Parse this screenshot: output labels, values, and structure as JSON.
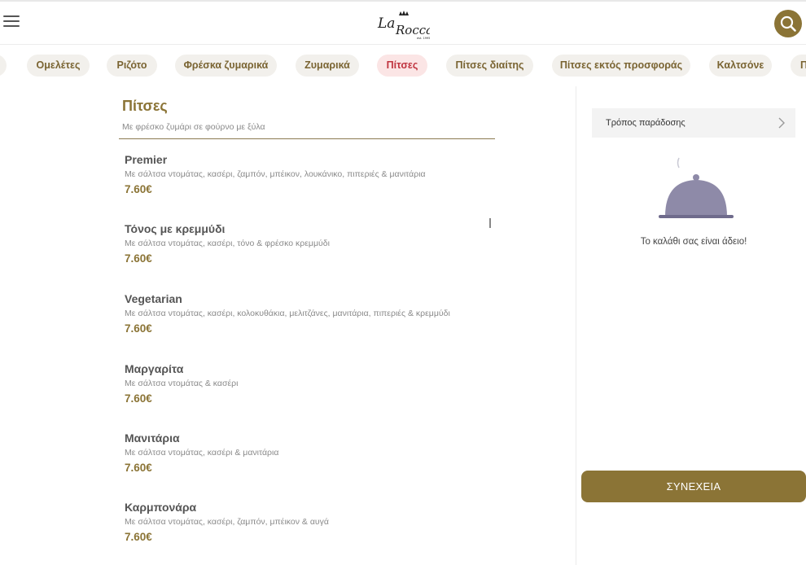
{
  "header": {
    "logo_text": "La Rocca",
    "menu_icon": "hamburger-menu-icon",
    "search_icon": "search-icon",
    "accent_color": "#8b7436"
  },
  "categories": [
    {
      "label": "Ομελέτες",
      "active": false
    },
    {
      "label": "Ριζότο",
      "active": false
    },
    {
      "label": "Φρέσκα ζυμαρικά",
      "active": false
    },
    {
      "label": "Ζυμαρικά",
      "active": false
    },
    {
      "label": "Πίτσες",
      "active": true
    },
    {
      "label": "Πίτσες διαίτης",
      "active": false
    },
    {
      "label": "Πίτσες εκτός προσφοράς",
      "active": false
    },
    {
      "label": "Καλτσόνε",
      "active": false
    },
    {
      "label": "Π",
      "active": false
    }
  ],
  "section": {
    "title": "Πίτσες",
    "subtitle": "Με φρέσκο ζυμάρι σε φούρνο με ξύλα"
  },
  "items": [
    {
      "name": "Premier",
      "desc": "Με σάλτσα ντομάτας, κασέρι, ζαμπόν, μπέικον, λουκάνικο, πιπεριές & μανιτάρια",
      "price": "7.60€"
    },
    {
      "name": "Τόνος με κρεμμύδι",
      "desc": "Με σάλτσα ντομάτας, κασέρι, τόνο & φρέσκο κρεμμύδι",
      "price": "7.60€"
    },
    {
      "name": "Vegetarian",
      "desc": "Με σάλτσα ντομάτας, κασέρι, κολοκυθάκια, μελιτζάνες, μανιτάρια, πιπεριές & κρεμμύδι",
      "price": "7.60€"
    },
    {
      "name": "Μαργαρίτα",
      "desc": "Με σάλτσα ντομάτας & κασέρι",
      "price": "7.60€"
    },
    {
      "name": "Μανιτάρια",
      "desc": "Με σάλτσα ντομάτας, κασέρι & μανιτάρια",
      "price": "7.60€"
    },
    {
      "name": "Καρμπονάρα",
      "desc": "Με σάλτσα ντομάτας, κασέρι, ζαμπόν, μπέικον & αυγά",
      "price": "7.60€"
    }
  ],
  "cart": {
    "delivery_label": "Τρόπος παράδοσης",
    "empty_text": "Το καλάθι σας είναι άδειο!",
    "continue_label": "ΣΥΝΕΧΕΙΑ",
    "cloche_icon": "cloche-icon",
    "cloche_color": "#8e8aa8"
  }
}
